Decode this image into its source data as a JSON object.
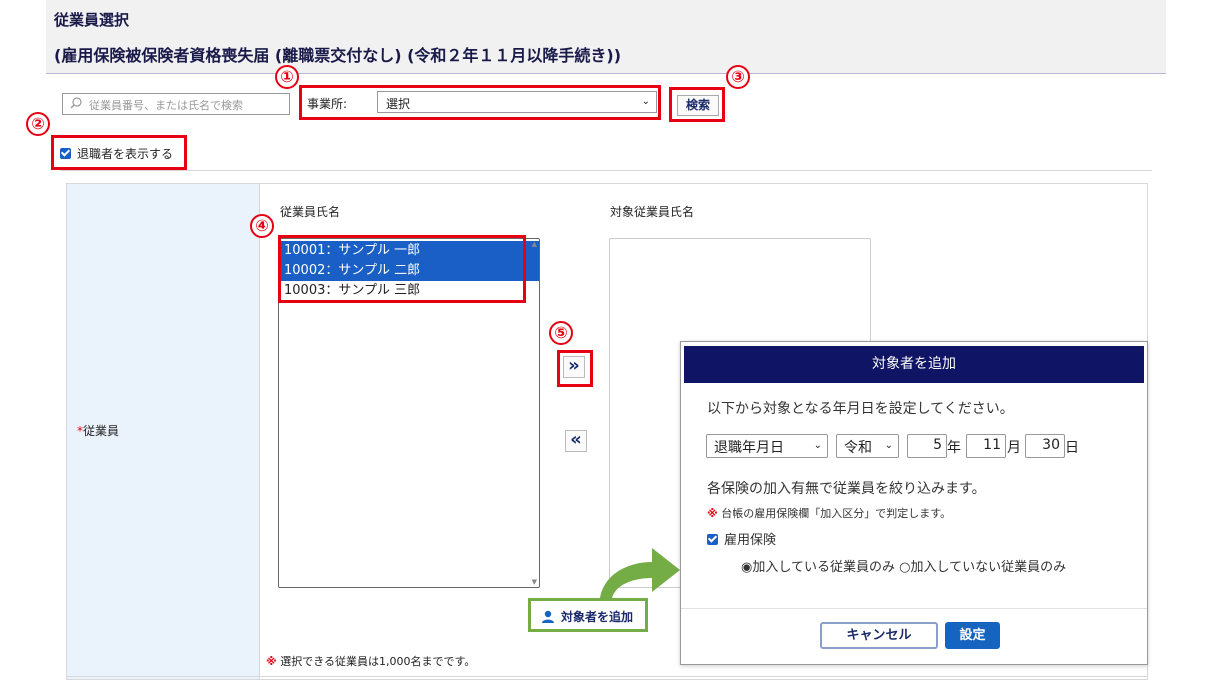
{
  "header": {
    "title": "従業員選択",
    "subtitle": "(雇用保険被保険者資格喪失届 (離職票交付なし) (令和２年１１月以降手続き))"
  },
  "search": {
    "placeholder": "従業員番号、または氏名で検索",
    "icon": "search-icon"
  },
  "office": {
    "label": "事業所:",
    "selected": "選択"
  },
  "search_button": "検索",
  "show_retired": {
    "label": "退職者を表示する",
    "checked": true
  },
  "markers": [
    "①",
    "②",
    "③",
    "④",
    "⑤"
  ],
  "employee_field": {
    "required_mark": "*",
    "label": "従業員"
  },
  "employee_list": {
    "header": "従業員氏名",
    "items": [
      {
        "text": "10001：サンプル 一郎",
        "selected": true
      },
      {
        "text": "10002：サンプル 二郎",
        "selected": true
      },
      {
        "text": "10003：サンプル 三郎",
        "selected": false
      }
    ]
  },
  "target_list": {
    "header": "対象従業員氏名",
    "items": []
  },
  "move_buttons": {
    "add": "»",
    "remove": "«"
  },
  "limit_note": {
    "mark": "※",
    "text": "選択できる従業員は1,000名までです。"
  },
  "add_target_button": "対象者を追加",
  "dialog": {
    "title": "対象者を追加",
    "instruction": "以下から対象となる年月日を設定してください。",
    "date_type": "退職年月日",
    "era": "令和",
    "year": "5",
    "year_unit": "年",
    "month": "11",
    "month_unit": "月",
    "day": "30",
    "day_unit": "日",
    "filter_text": "各保険の加入有無で従業員を絞り込みます。",
    "note_mark": "※",
    "note_text": "台帳の雇用保険欄「加入区分」で判定します。",
    "insurance_label": "雇用保険",
    "insurance_checked": true,
    "radio_enrolled": "加入している従業員のみ",
    "radio_not_enrolled": "加入していない従業員のみ",
    "radio_selected": "enrolled",
    "cancel_button": "キャンセル",
    "set_button": "設定"
  },
  "colors": {
    "accent_red": "#e60012",
    "selection_blue": "#1a5fc6",
    "dialog_header": "#0f1464",
    "highlight_green": "#74ac45",
    "set_button": "#1565c0"
  }
}
